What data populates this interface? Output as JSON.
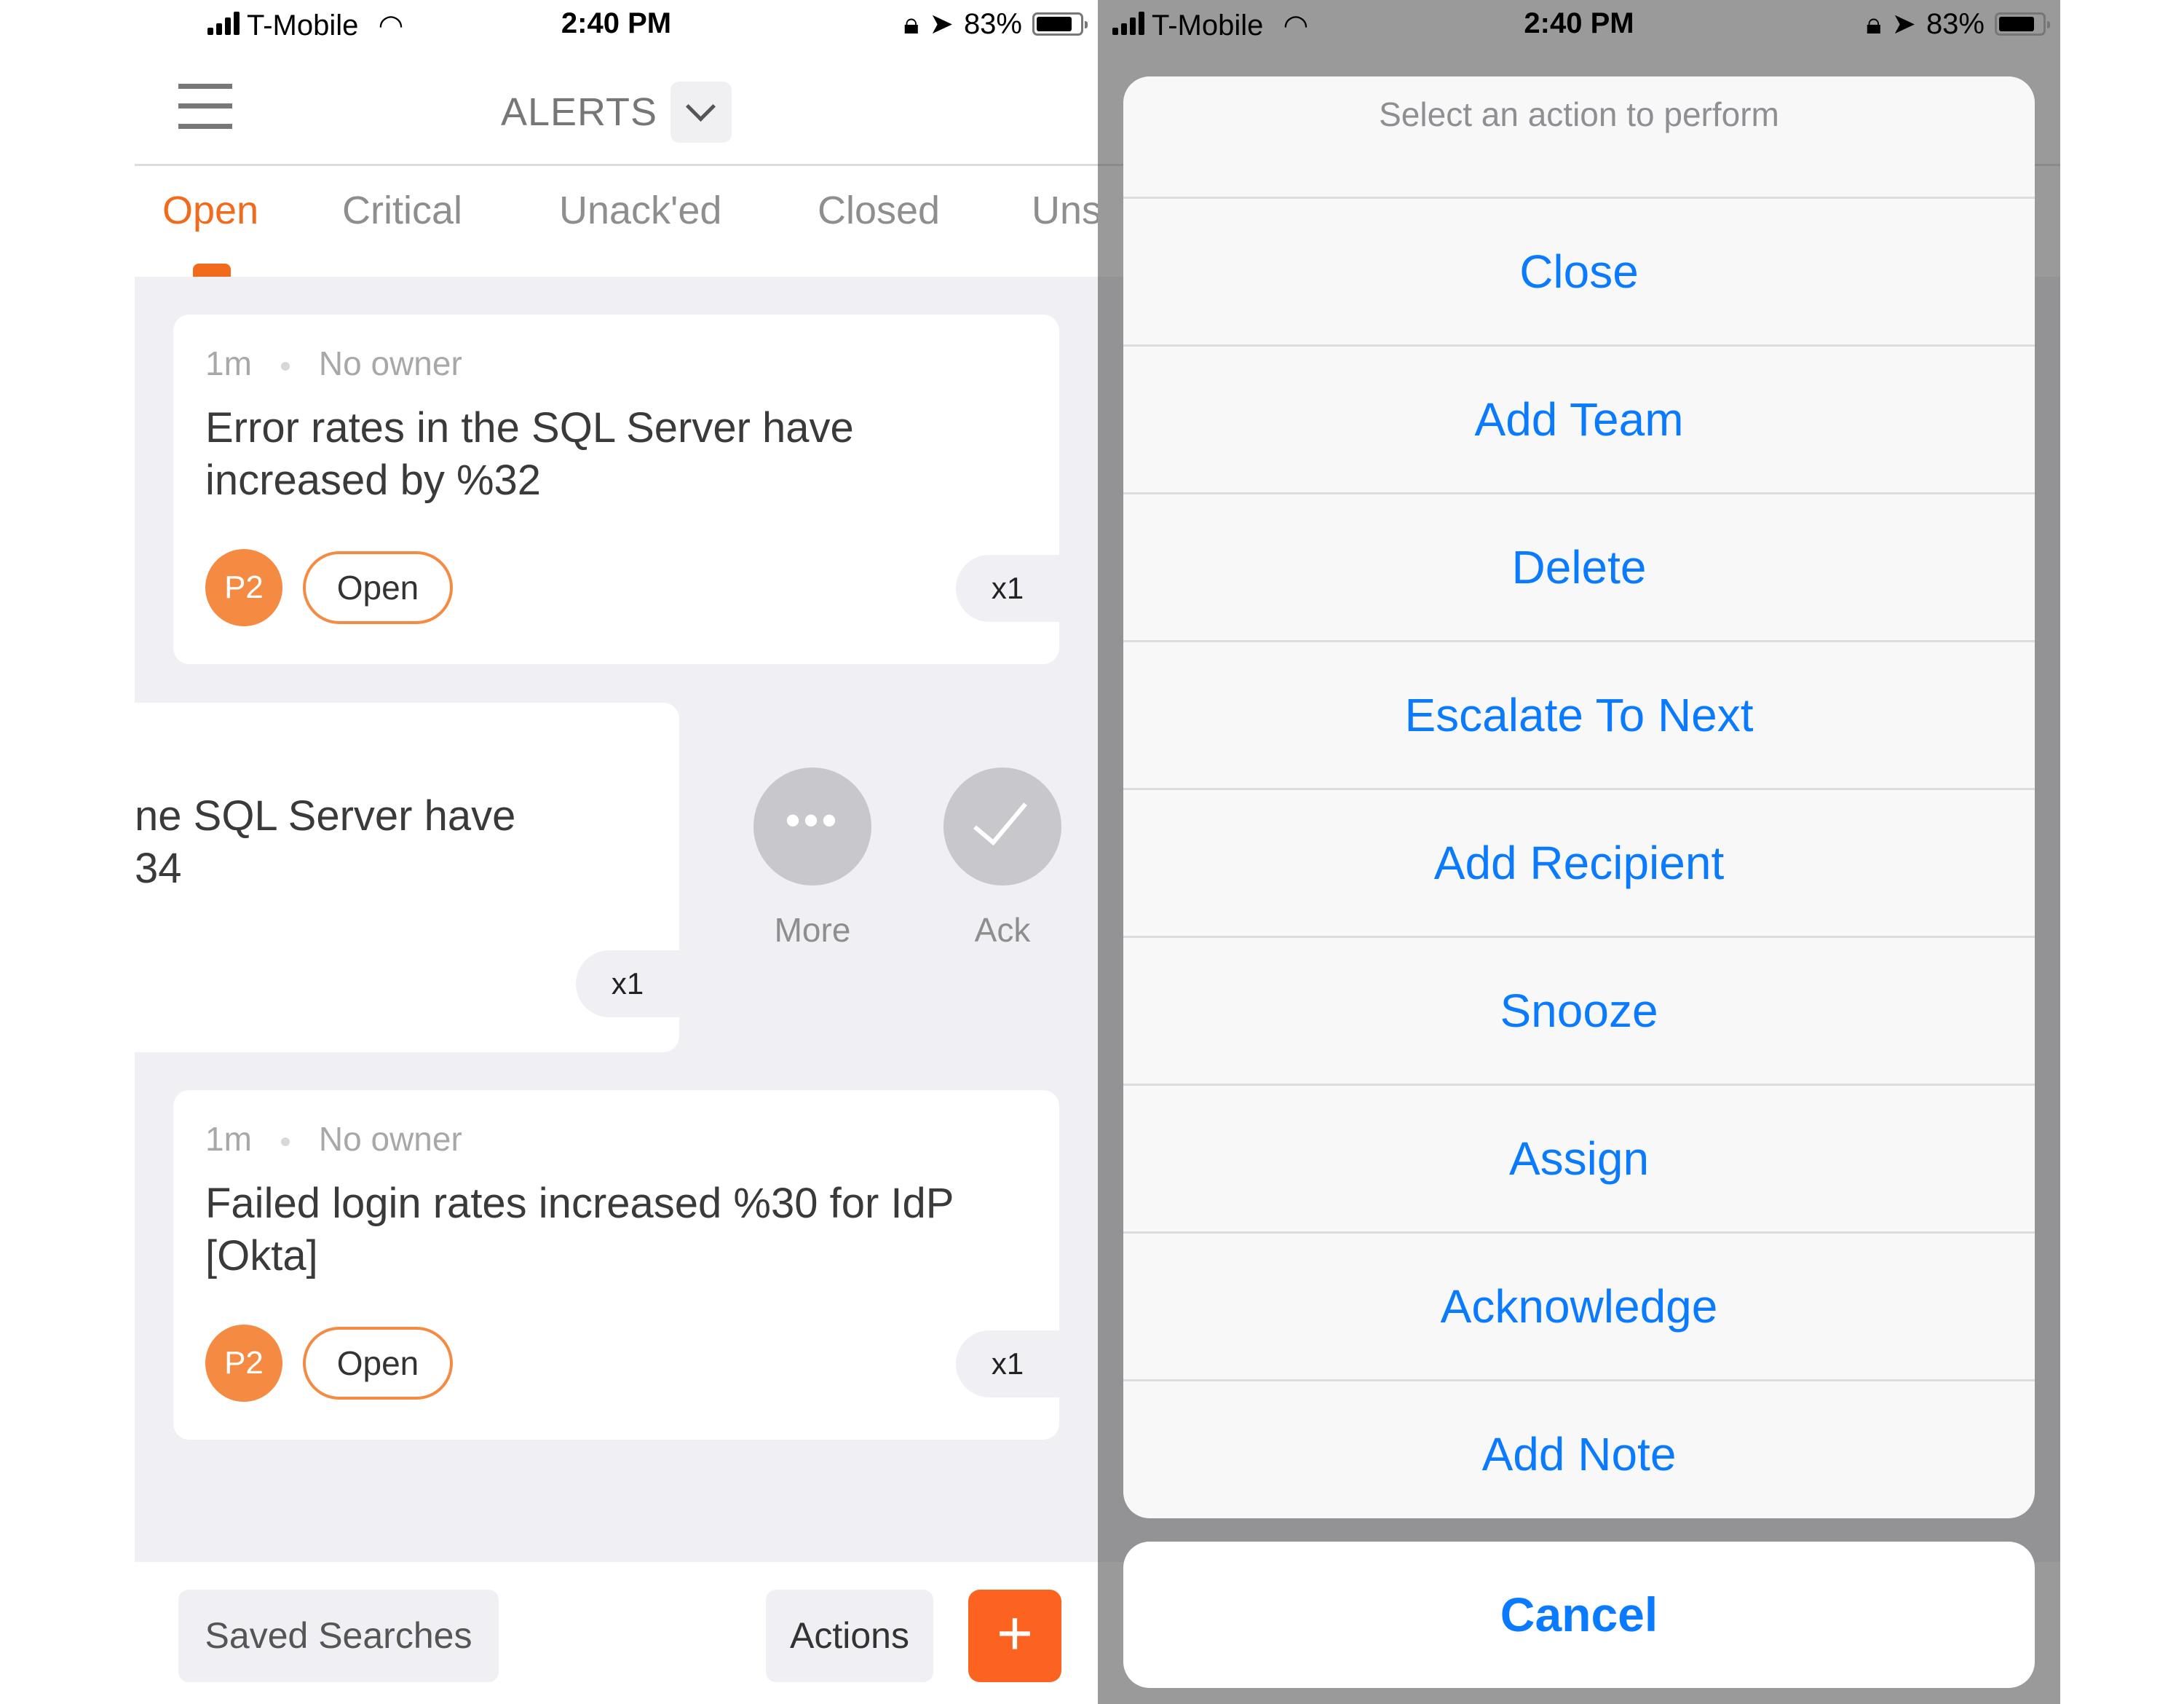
{
  "status_bar": {
    "carrier": "T-Mobile",
    "time": "2:40 PM",
    "battery": "83%",
    "icons": [
      "signal-icon",
      "wifi-icon",
      "orientation-lock-icon",
      "location-icon",
      "battery-icon"
    ]
  },
  "header": {
    "menu_icon": "hamburger-icon",
    "title": "ALERTS",
    "dropdown_icon": "chevron-down-icon"
  },
  "tabs": [
    {
      "label": "Open",
      "active": true
    },
    {
      "label": "Critical",
      "active": false
    },
    {
      "label": "Unack'ed",
      "active": false
    },
    {
      "label": "Closed",
      "active": false
    },
    {
      "label": "Uns",
      "active": false
    }
  ],
  "alerts": [
    {
      "age": "1m",
      "owner": "No owner",
      "message": "Error rates in the SQL Server have increased by %32",
      "priority": "P2",
      "status": "Open",
      "count": "x1"
    },
    {
      "message_visible": "ne SQL Server have\n34",
      "count": "x1",
      "swipe_actions": [
        {
          "label": "More",
          "icon": "more-dots-icon"
        },
        {
          "label": "Ack",
          "icon": "checkmark-icon"
        }
      ]
    },
    {
      "age": "1m",
      "owner": "No owner",
      "message": "Failed login rates increased %30 for IdP [Okta]",
      "priority": "P2",
      "status": "Open",
      "count": "x1"
    }
  ],
  "bottom_bar": {
    "saved_searches": "Saved Searches",
    "actions": "Actions",
    "add_icon": "plus-icon",
    "add_label": "+"
  },
  "colors": {
    "accent_orange": "#f26b1d",
    "priority_orange": "#f58a42",
    "ios_blue": "#0a7aff",
    "content_bg": "#efeff4"
  },
  "action_sheet": {
    "title": "Select an action to perform",
    "actions": [
      "Close",
      "Add Team",
      "Delete",
      "Escalate To Next",
      "Add Recipient",
      "Snooze",
      "Assign",
      "Acknowledge",
      "Add Note"
    ],
    "cancel": "Cancel"
  }
}
